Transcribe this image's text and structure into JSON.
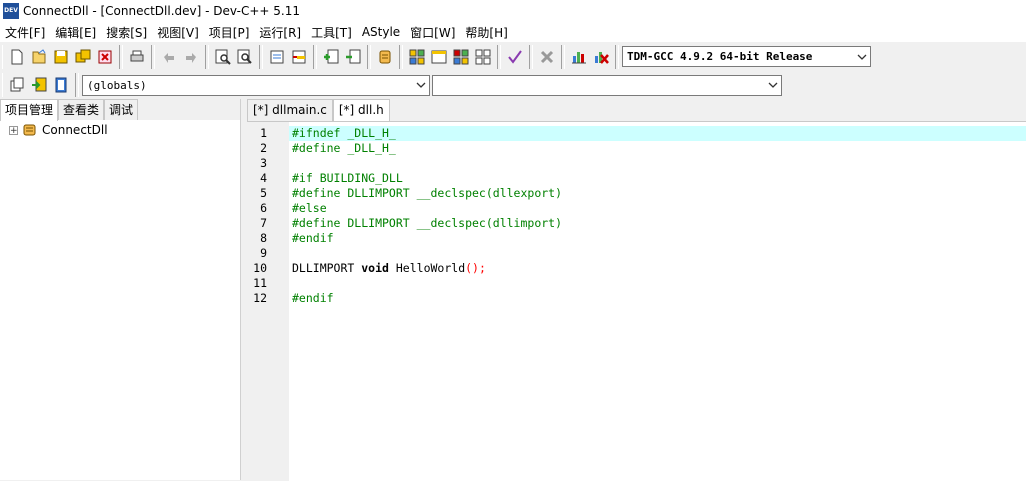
{
  "window": {
    "title": "ConnectDll - [ConnectDll.dev] - Dev-C++ 5.11",
    "app_icon_text": "DEV"
  },
  "menu": [
    {
      "label": "文件[F]"
    },
    {
      "label": "编辑[E]"
    },
    {
      "label": "搜索[S]"
    },
    {
      "label": "视图[V]"
    },
    {
      "label": "项目[P]"
    },
    {
      "label": "运行[R]"
    },
    {
      "label": "工具[T]"
    },
    {
      "label": "AStyle"
    },
    {
      "label": "窗口[W]"
    },
    {
      "label": "帮助[H]"
    }
  ],
  "toolbar": {
    "compiler_select": "TDM-GCC 4.9.2 64-bit Release",
    "scope_select": "(globals)",
    "member_select": ""
  },
  "left_panel": {
    "tabs": [
      {
        "label": "项目管理"
      },
      {
        "label": "查看类"
      },
      {
        "label": "调试"
      }
    ],
    "tree": [
      {
        "label": "ConnectDll",
        "expander": "+"
      }
    ]
  },
  "editor": {
    "tabs": [
      {
        "label": "[*] dllmain.c"
      },
      {
        "label": "[*] dll.h"
      }
    ],
    "lines": [
      {
        "num": "1",
        "segments": [
          {
            "t": "#ifndef _DLL_H_",
            "c": "pp"
          }
        ]
      },
      {
        "num": "2",
        "segments": [
          {
            "t": "#define _DLL_H_",
            "c": "pp"
          }
        ]
      },
      {
        "num": "3",
        "segments": []
      },
      {
        "num": "4",
        "segments": [
          {
            "t": "#if BUILDING_DLL",
            "c": "pp"
          }
        ]
      },
      {
        "num": "5",
        "segments": [
          {
            "t": "#define DLLIMPORT __declspec(dllexport)",
            "c": "pp"
          }
        ]
      },
      {
        "num": "6",
        "segments": [
          {
            "t": "#else",
            "c": "pp"
          }
        ]
      },
      {
        "num": "7",
        "segments": [
          {
            "t": "#define DLLIMPORT __declspec(dllimport)",
            "c": "pp"
          }
        ]
      },
      {
        "num": "8",
        "segments": [
          {
            "t": "#endif",
            "c": "pp"
          }
        ]
      },
      {
        "num": "9",
        "segments": []
      },
      {
        "num": "10",
        "segments": [
          {
            "t": "DLLIMPORT ",
            "c": "ident"
          },
          {
            "t": "void",
            "c": "kw"
          },
          {
            "t": " HelloWorld",
            "c": "ident"
          },
          {
            "t": "();",
            "c": "punct"
          }
        ]
      },
      {
        "num": "11",
        "segments": []
      },
      {
        "num": "12",
        "segments": [
          {
            "t": "#endif",
            "c": "pp"
          }
        ]
      }
    ],
    "highlighted_line": "1"
  },
  "colors": {
    "preprocessor": "#008000",
    "punct": "#ff0000",
    "current_line": "#ccffff"
  }
}
